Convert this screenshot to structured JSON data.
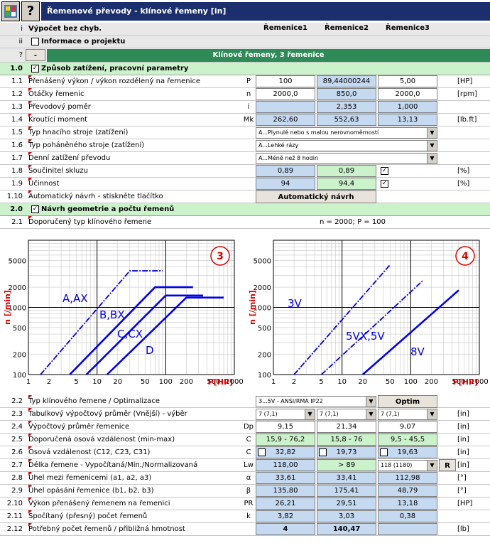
{
  "window": {
    "title": "Řemenové převody - klínové řemeny [in]",
    "icon1": "app-settings-icon",
    "icon2": "help-icon"
  },
  "header": {
    "row_i": "i",
    "status": "Výpočet bez chyb.",
    "col1": "Řemenice1",
    "col2": "Řemenice2",
    "col3": "Řemenice3"
  },
  "project": {
    "row": "ii",
    "label": "Informace o projektu"
  },
  "band": {
    "row": "?",
    "minus": "-",
    "title": "Klínové řemeny, 3 řemenice"
  },
  "section1": {
    "num": "1.0",
    "title": "Způsob zatížení, pracovní parametry"
  },
  "rows1": [
    {
      "n": "1.1",
      "label": "Přenášený výkon / výkon rozdělený na řemenice",
      "sym": "P",
      "v1": "100",
      "v2": "89,44000244",
      "v3": "5,00",
      "unit": "[HP]"
    },
    {
      "n": "1.2",
      "label": "Otáčky řemenic",
      "sym": "n",
      "v1": "2000,0",
      "v2": "850,0",
      "v3": "2000,0",
      "unit": "[rpm]"
    },
    {
      "n": "1.3",
      "label": "Převodový poměr",
      "sym": "i",
      "v1": "",
      "v2": "2,353",
      "v3": "1,000",
      "unit": ""
    },
    {
      "n": "1.4",
      "label": "Kroutící moment",
      "sym": "Mk",
      "v1": "262,60",
      "v2": "552,63",
      "v3": "13,13",
      "unit": "[lb.ft]"
    },
    {
      "n": "1.5",
      "label": "Typ hnacího stroje (zatížení)",
      "dd": "A...Plynulé nebo s malou nerovnoměrností"
    },
    {
      "n": "1.6",
      "label": "Typ poháněného stroje (zatížení)",
      "dd": "A...Lehké rázy"
    },
    {
      "n": "1.7",
      "label": "Denní zatížení převodu",
      "dd": "A...Méně než 8 hodin"
    },
    {
      "n": "1.8",
      "label": "Součinitel skluzu",
      "v1": "0,89",
      "v2": "0,89",
      "unit": "[%]"
    },
    {
      "n": "1.9",
      "label": "Účinnost",
      "v1": "94",
      "v2": "94,4",
      "unit": "[%]"
    },
    {
      "n": "1.10",
      "label": "Automatický návrh - stiskněte tlačítko",
      "btn": "Automatický návrh"
    }
  ],
  "section2": {
    "num": "2.0",
    "title": "Návrh geometrie a počtu řemenů"
  },
  "row21": {
    "n": "2.1",
    "label": "Doporučený typ klínového řemene",
    "info": "n = 2000; P = 100"
  },
  "chart_data": [
    {
      "type": "line",
      "panel": "3",
      "xlabel": "P[HP]",
      "ylabel": "n [/min]",
      "xscale": "log",
      "yscale": "log",
      "xlim": [
        1,
        1000
      ],
      "ylim": [
        100,
        10000
      ],
      "xticks": [
        "1",
        "2",
        "5",
        "10",
        "20",
        "50",
        "100",
        "200",
        "500",
        "1000"
      ],
      "yticks": [
        "100",
        "200",
        "500",
        "1000",
        "2000",
        "5000"
      ],
      "series": [
        {
          "name": "A,AX",
          "x": [
            1.5,
            30,
            90
          ],
          "y": [
            100,
            3500,
            3500
          ],
          "style": "dashdot"
        },
        {
          "name": "B,BX",
          "x": [
            4,
            70,
            250
          ],
          "y": [
            100,
            2000,
            2000
          ]
        },
        {
          "name": "C,CX",
          "x": [
            7,
            100,
            350
          ],
          "y": [
            100,
            1500,
            1500
          ]
        },
        {
          "name": "D",
          "x": [
            14,
            200,
            700
          ],
          "y": [
            100,
            1400,
            1400
          ]
        }
      ]
    },
    {
      "type": "line",
      "panel": "4",
      "xlabel": "P[HP]",
      "ylabel": "n [/min]",
      "xscale": "log",
      "yscale": "log",
      "xlim": [
        1,
        1000
      ],
      "ylim": [
        100,
        10000
      ],
      "xticks": [
        "1",
        "2",
        "5",
        "10",
        "20",
        "50",
        "100",
        "200",
        "500",
        "1000"
      ],
      "yticks": [
        "100",
        "200",
        "500",
        "1000",
        "2000",
        "5000"
      ],
      "series": [
        {
          "name": "3V",
          "x": [
            2,
            50
          ],
          "y": [
            100,
            4300
          ],
          "style": "dashdot"
        },
        {
          "name": "5VX,5V",
          "x": [
            5,
            150
          ],
          "y": [
            100,
            2500
          ],
          "style": "dashdot"
        },
        {
          "name": "8V",
          "x": [
            20,
            500
          ],
          "y": [
            100,
            1800
          ]
        }
      ]
    }
  ],
  "row22": {
    "n": "2.2",
    "label": "Typ klínového řemene / Optimalizace",
    "dd": "3...5V - ANSI/RMA IP22",
    "btn": "Optim"
  },
  "row23": {
    "n": "2.3",
    "label": "Tabulkový výpočtový průměr (Vnější) - výběr",
    "d1": "7 (7,1)",
    "d2": "7 (7,1)",
    "d3": "7 (7,1)",
    "unit": "[in]"
  },
  "rows2": [
    {
      "n": "2.4",
      "label": "Výpočtový průměr řemenice",
      "sym": "Dp",
      "v1": "9,15",
      "v2": "21,34",
      "v3": "9,07",
      "unit": "[in]"
    },
    {
      "n": "2.5",
      "label": "Doporučená osová vzdálenost (min-max)",
      "sym": "C",
      "v1": "15,9 - 76,2",
      "v2": "15,8 - 76",
      "v3": "9,5 - 45,5",
      "unit": "[in]"
    },
    {
      "n": "2.6",
      "label": "Osová vzdálenost (C12, C23, C31)",
      "sym": "C",
      "v1": "32,82",
      "v2": "19,73",
      "v3": "19,63",
      "unit": "[in]"
    },
    {
      "n": "2.7",
      "label": "Délka řemene - Vypočítaná/Min./Normalizovaná",
      "sym": "Lw",
      "v1": "118,00",
      "v2": "> 89",
      "dd": "118 (1180)",
      "btn": "R",
      "unit": "[in]"
    },
    {
      "n": "2.8",
      "label": "Úhel mezi řemenicemi (a1, a2, a3)",
      "sym": "α",
      "v1": "33,61",
      "v2": "33,41",
      "v3": "112,98",
      "unit": "[°]"
    },
    {
      "n": "2.9",
      "label": "Úhel opásání řemenice (b1, b2, b3)",
      "sym": "β",
      "v1": "135,80",
      "v2": "175,41",
      "v3": "48,79",
      "unit": "[°]"
    },
    {
      "n": "2.10",
      "label": "Výkon přenášený řemenem na řemenici",
      "sym": "PR",
      "v1": "26,21",
      "v2": "29,51",
      "v3": "13,18",
      "unit": "[HP]"
    },
    {
      "n": "2.11",
      "label": "Spočítaný (přesný) počet řemenů",
      "sym": "k",
      "v1": "3,82",
      "v2": "3,03",
      "v3": "0,38",
      "unit": ""
    },
    {
      "n": "2.12",
      "label": "Potřebný počet řemenů / přibližná hmotnost",
      "sym": "",
      "v1": "4",
      "v2": "140,47",
      "v3": "",
      "unit": "[lb]"
    }
  ]
}
